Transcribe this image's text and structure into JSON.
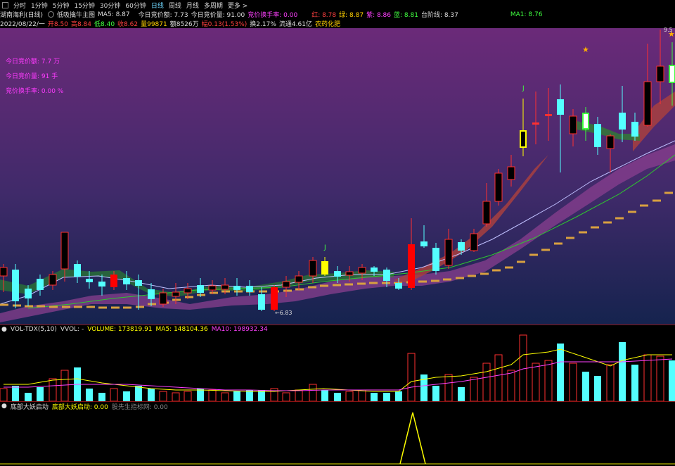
{
  "toolbar": {
    "periods": [
      "分时",
      "1分钟",
      "5分钟",
      "15分钟",
      "30分钟",
      "60分钟",
      "日线",
      "周线",
      "月线",
      "多周期"
    ],
    "selected": "日线",
    "more": "更多 >"
  },
  "header": {
    "stock": "湖南海利(日线)",
    "indicator": "低吸擒牛主图",
    "ma5": "MA5: 8.87",
    "bid_amount": "今日竞价额: 7.73",
    "bid_volume": "今日竞价量: 91.00",
    "bid_turnover": "竞价换手率: 0.00",
    "red": "红: 8.78",
    "green": "绿: 8.87",
    "purple": "紫: 8.86",
    "blue": "蓝: 8.81",
    "step": "台阶线: 8.37",
    "ma1": "MA1: 8.76"
  },
  "quote": {
    "date": "2022/08/22/一",
    "open": "开8.50",
    "high": "高8.84",
    "low": "低8.40",
    "close": "收8.62",
    "volume": "量99871",
    "amount": "额8526万",
    "change": "幅0.13(1.53%)",
    "turnover": "换2.17%",
    "float": "流通4.61亿",
    "sector": "农药化肥"
  },
  "annotations": {
    "line1": "今日竞价额: 7.7 万",
    "line2": "今日竞价量: 91 手",
    "line3": "竞价换手率: 0.00 %",
    "low_price": "←6.83",
    "high_price": "9.5"
  },
  "volume_panel": {
    "title": "VOL-TDX(5,10)",
    "vvol": "VVOL: -",
    "volume": "VOLUME: 173819.91",
    "ma5": "MA5: 148104.36",
    "ma10": "MA10: 198932.34"
  },
  "signal_panel": {
    "title": "底部大妖启动",
    "label": "底部大妖启动: 0.00",
    "label2": "股先生指标网: 0.00"
  },
  "colors": {
    "up": "#ff3030",
    "down": "#54ffff",
    "yellow": "#ffff00",
    "magenta": "#ff40ff",
    "step": "#d8a040"
  }
}
